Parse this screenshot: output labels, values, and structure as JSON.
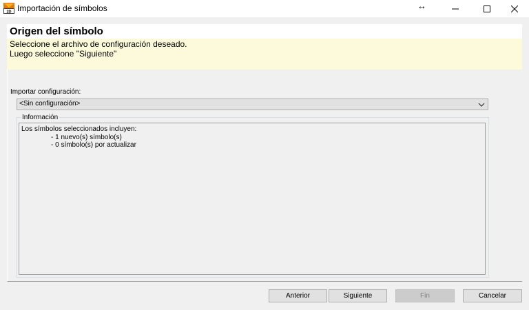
{
  "window": {
    "title": "Importación de símbolos",
    "icon": "app-2d-icon",
    "controls": {
      "resize_glyph": "↔",
      "minimize": "minimize-icon",
      "maximize": "maximize-icon",
      "close": "close-icon"
    }
  },
  "header": {
    "title": "Origen del símbolo",
    "line1": "Seleccione el archivo de configuración deseado.",
    "line2": "Luego seleccione \"Siguiente\"",
    "background_color": "#fcfadb"
  },
  "import_config": {
    "label": "Importar configuración:",
    "selected_value": "<Sin configuración>"
  },
  "info": {
    "legend": "Información",
    "lines": [
      "Los símbolos seleccionados incluyen:",
      "- 1 nuevo(s) símbolo(s)",
      "- 0 símbolo(s) por actualizar"
    ]
  },
  "buttons": {
    "previous": "Anterior",
    "next": "Siguiente",
    "finish": "Fin",
    "cancel": "Cancelar"
  }
}
